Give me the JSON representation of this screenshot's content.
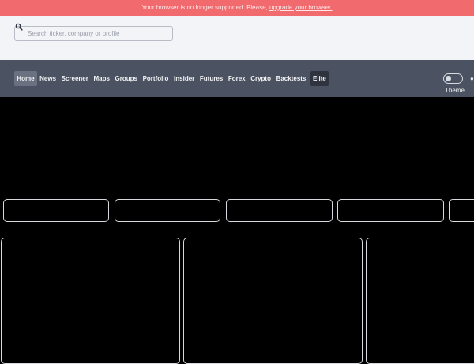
{
  "banner": {
    "message": "Your browser is no longer supported. Please,",
    "link_text": "upgrade your browser."
  },
  "search": {
    "placeholder": "Search ticker, company or profile"
  },
  "nav": {
    "items": [
      "Home",
      "News",
      "Screener",
      "Maps",
      "Groups",
      "Portfolio",
      "Insider",
      "Futures",
      "Forex",
      "Crypto",
      "Backtests",
      "Elite"
    ],
    "active": "Home"
  },
  "theme": {
    "label": "Theme"
  },
  "colors": {
    "banner_bg": "#f06a6e",
    "search_bg": "#f3f4f8",
    "nav_bg": "#4b5261",
    "content_bg": "#000000",
    "card_border": "#d7d9de"
  },
  "icons": {
    "search": "search-icon",
    "theme": "toggle-switch",
    "nav_edge": "partial-icon"
  }
}
